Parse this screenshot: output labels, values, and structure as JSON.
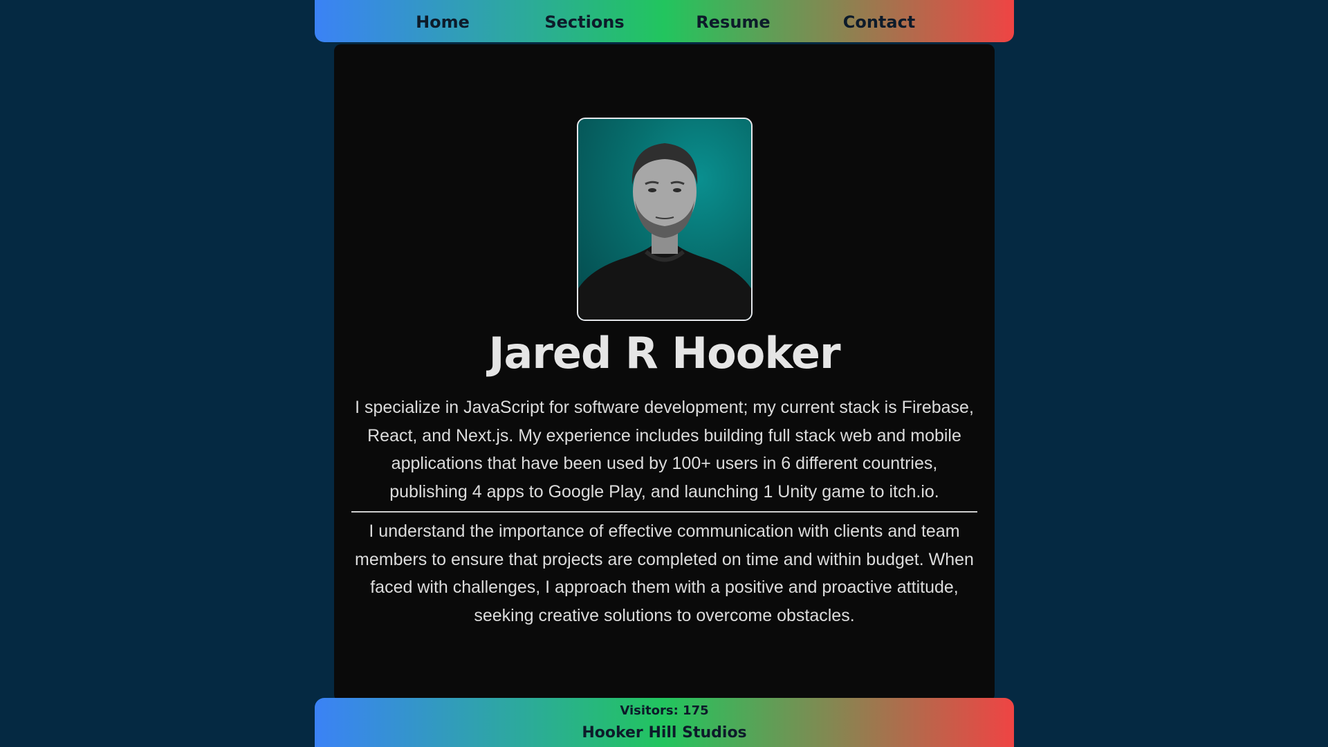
{
  "nav": {
    "items": [
      {
        "label": "Home"
      },
      {
        "label": "Sections"
      },
      {
        "label": "Resume"
      },
      {
        "label": "Contact"
      }
    ]
  },
  "profile": {
    "name": "Jared R Hooker",
    "bio_primary": "I specialize in JavaScript for software development; my current stack is Firebase, React, and Next.js. My experience includes building full stack web and mobile applications that have been used by 100+ users in 6 different countries, publishing 4 apps to Google Play, and launching 1 Unity game to itch.io.",
    "bio_secondary": "I understand the importance of effective communication with clients and team members to ensure that projects are completed on time and within budget. When faced with challenges, I approach them with a positive and proactive attitude, seeking creative solutions to overcome obstacles."
  },
  "footer": {
    "visitors": "Visitors: 175",
    "studio": "Hooker Hill Studios"
  },
  "colors": {
    "page_background": "#052942",
    "card_background": "#0a0a0a",
    "gradient_start": "#3b82f6",
    "gradient_mid": "#22c55e",
    "gradient_end": "#ef4444",
    "text_light": "#e5e5e5",
    "text_dark": "#0d1b2a"
  }
}
